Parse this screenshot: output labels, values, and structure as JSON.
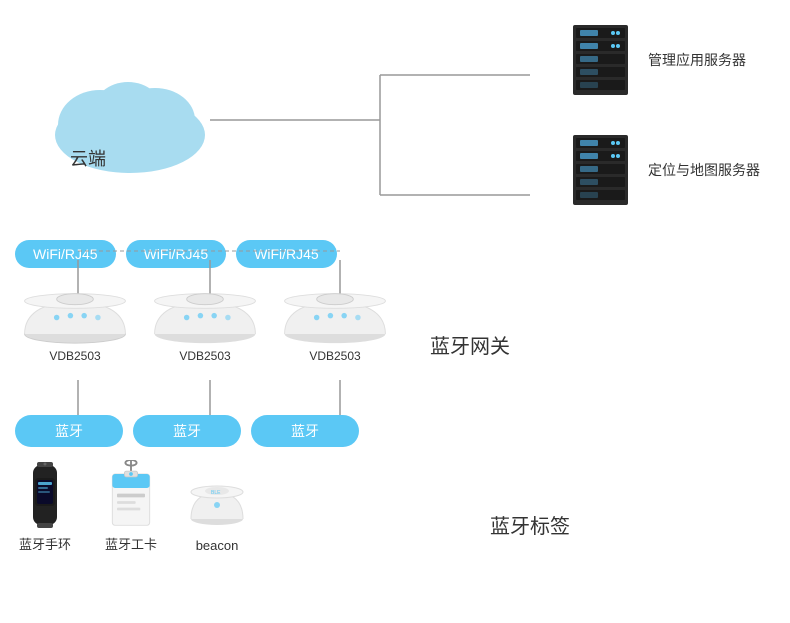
{
  "cloud": {
    "label": "云端"
  },
  "servers": [
    {
      "label": "管理应用服务器"
    },
    {
      "label": "定位与地图服务器"
    }
  ],
  "wifi_badges": [
    "WiFi/RJ45",
    "WiFi/RJ45",
    "WiFi/RJ45"
  ],
  "gateways": [
    {
      "label": "VDB2503"
    },
    {
      "label": "VDB2503"
    },
    {
      "label": "VDB2503"
    }
  ],
  "bluetooth_gateway_label": "蓝牙网关",
  "bluetooth_badges": [
    "蓝牙",
    "蓝牙",
    "蓝牙"
  ],
  "bt_tags": [
    {
      "label": "蓝牙手环"
    },
    {
      "label": "蓝牙工卡"
    },
    {
      "label": "beacon"
    }
  ],
  "bluetooth_tag_label": "蓝牙标签",
  "colors": {
    "blue_badge": "#5bc8f5",
    "cloud_fill": "#a8dcf0",
    "server_dark": "#2a2a2a",
    "server_blue": "#4a9ece",
    "line_color": "#999"
  }
}
